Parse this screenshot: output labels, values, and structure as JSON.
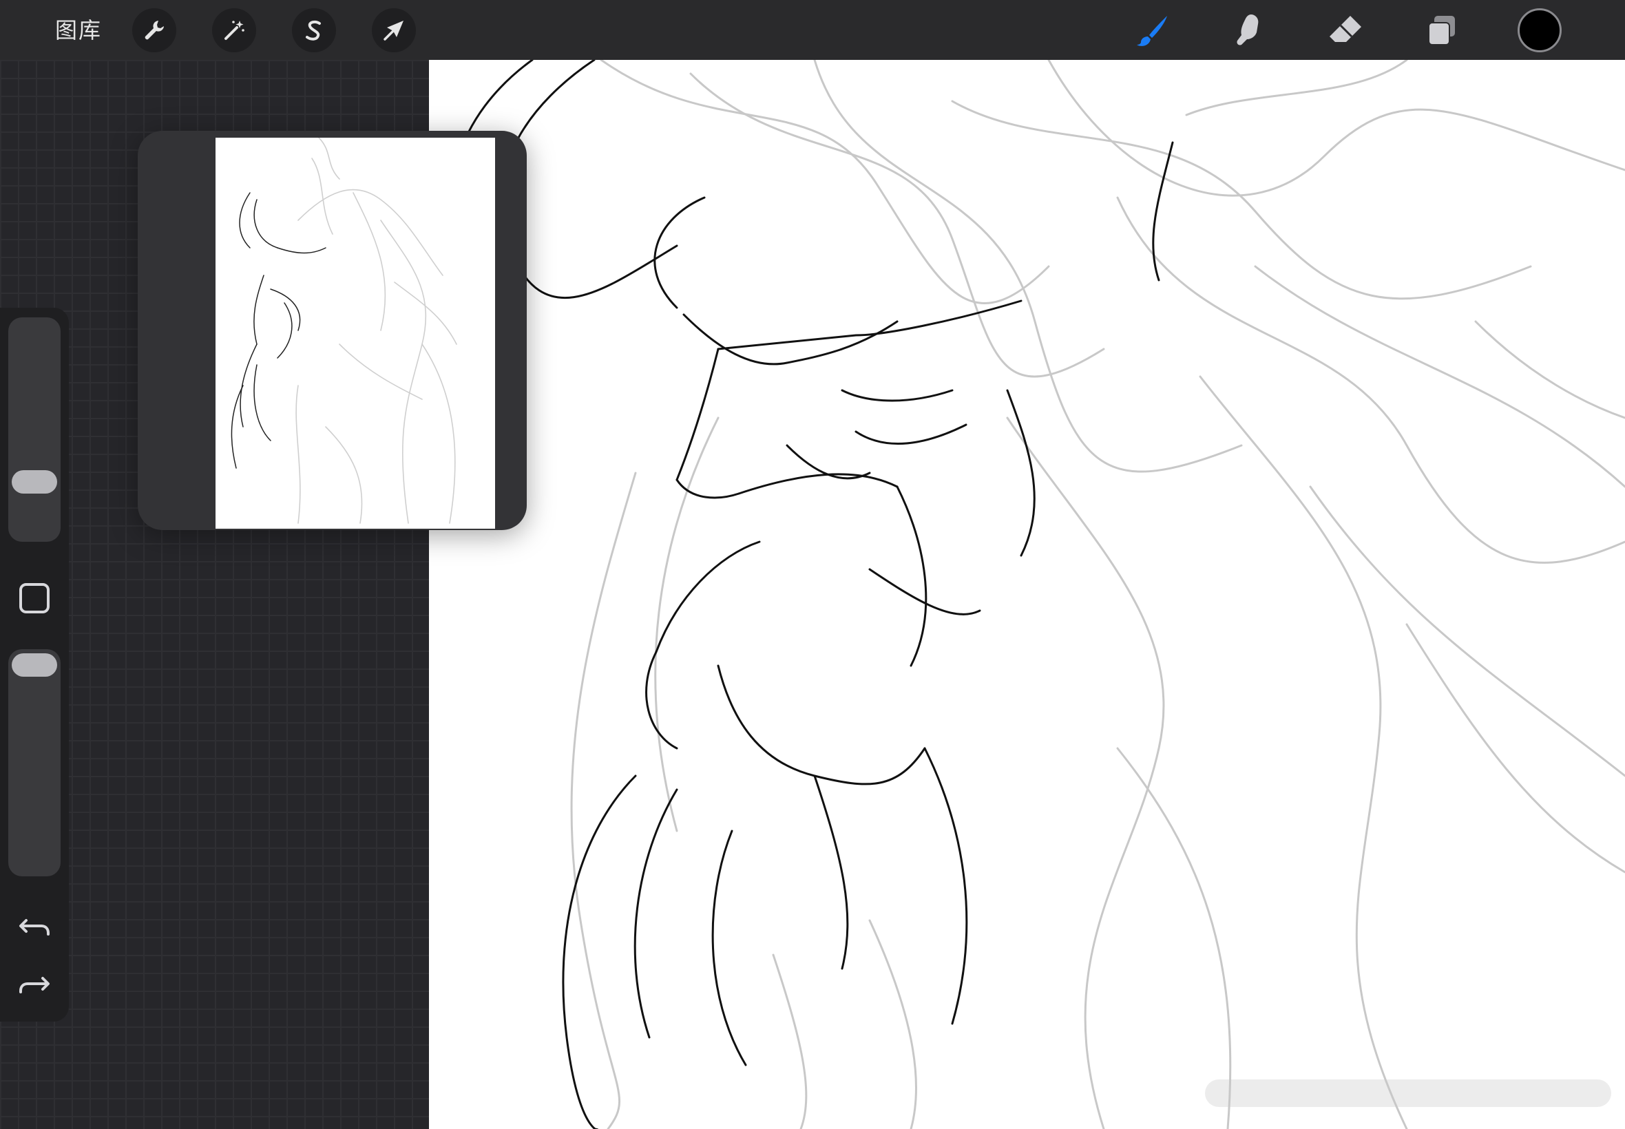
{
  "topbar": {
    "gallery_label": "图库",
    "left_tools": [
      {
        "name": "actions",
        "icon": "wrench-icon"
      },
      {
        "name": "adjustments",
        "icon": "magic-wand-icon"
      },
      {
        "name": "selection",
        "icon": "selection-s-icon"
      },
      {
        "name": "transform",
        "icon": "arrow-cursor-icon"
      }
    ],
    "right_tools": [
      {
        "name": "brush",
        "icon": "brush-icon",
        "active": true
      },
      {
        "name": "smudge",
        "icon": "smudge-icon",
        "active": false
      },
      {
        "name": "eraser",
        "icon": "eraser-icon",
        "active": false
      },
      {
        "name": "layers",
        "icon": "layers-icon",
        "active": false
      }
    ],
    "current_color": "#000000",
    "active_color": "#1a7cf5"
  },
  "sidebar": {
    "brush_size_level": 0.68,
    "opacity_level": 1.0,
    "undo_icon": "undo-icon",
    "redo_icon": "redo-icon",
    "modify_icon": "square-modify-icon"
  },
  "reference": {
    "title": ""
  }
}
